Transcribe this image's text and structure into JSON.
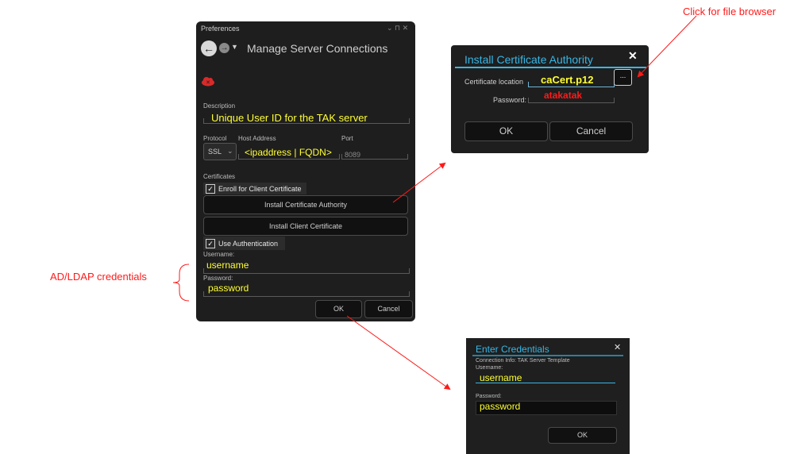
{
  "preferences": {
    "window_title": "Preferences",
    "window_controls": "⌄ ⊓ ✕",
    "page_title": "Manage Server Connections",
    "description_label": "Description",
    "description_value": "Unique User ID for the TAK server",
    "protocol_label": "Protocol",
    "protocol_value": "SSL",
    "host_label": "Host Address",
    "host_value": "<ipaddress | FQDN>",
    "port_label": "Port",
    "port_value": "8089",
    "certificates_label": "Certificates",
    "enroll_label": "Enroll for Client Certificate",
    "install_ca_button": "Install Certificate Authority",
    "install_client_button": "Install Client Certificate",
    "use_auth_label": "Use Authentication",
    "username_label": "Username:",
    "username_value": "username",
    "password_label": "Password:",
    "password_value": "password",
    "ok_button": "OK",
    "cancel_button": "Cancel"
  },
  "ca_dialog": {
    "title": "Install Certificate Authority",
    "close": "✕",
    "location_label": "Certificate location",
    "location_value": "caCert.p12",
    "browse_button": "...",
    "password_label": "Password:",
    "password_value": "atakatak",
    "ok_button": "OK",
    "cancel_button": "Cancel"
  },
  "cred_dialog": {
    "title": "Enter Credentials",
    "close": "✕",
    "connection_info": "Connection Info: TAK Server Template",
    "username_label": "Username:",
    "username_value": "username",
    "password_label": "Password:",
    "password_value": "password",
    "ok_button": "OK"
  },
  "annotations": {
    "file_browser": "Click for file browser",
    "credentials": "AD/LDAP credentials"
  },
  "colors": {
    "accent": "#37b7e6",
    "annotation": "#ff1a1a",
    "highlight_text": "#ffff33",
    "panel": "#1e1e1e"
  }
}
